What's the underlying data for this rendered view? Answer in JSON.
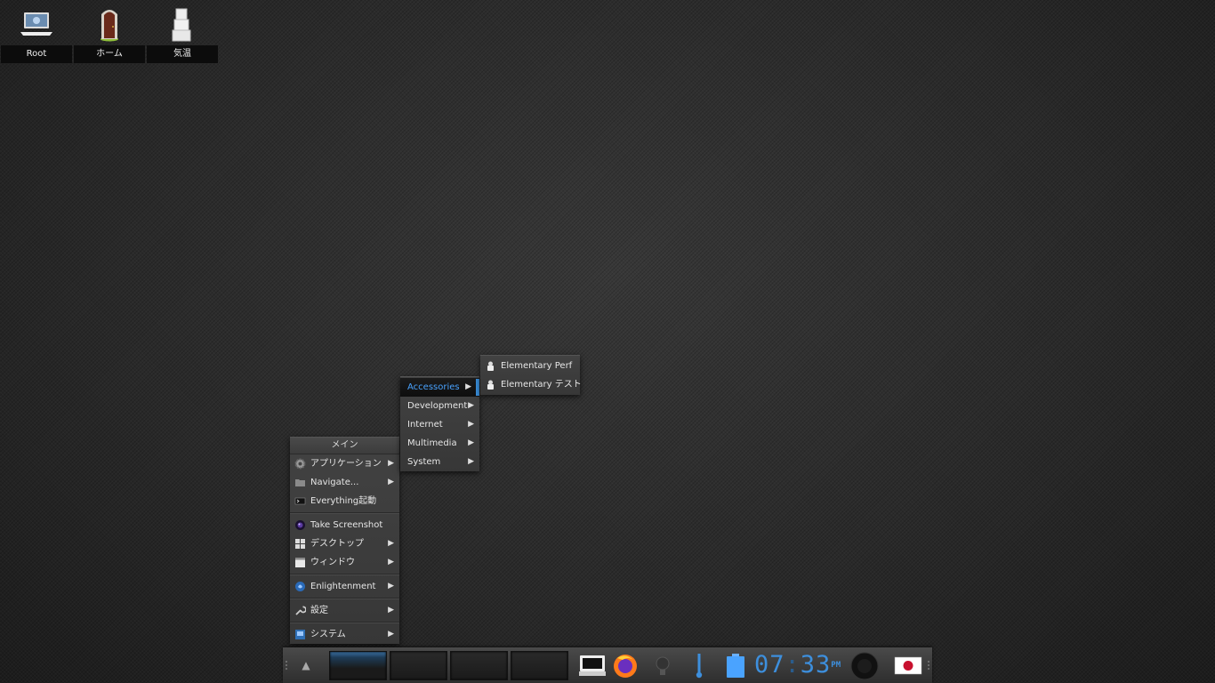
{
  "desktop_icons": [
    {
      "label": "Root",
      "icon": "computer-icon"
    },
    {
      "label": "ホーム",
      "icon": "home-door-icon"
    },
    {
      "label": "気温",
      "icon": "temperature-icon"
    }
  ],
  "main_menu": {
    "title": "メイン",
    "items": [
      {
        "label": "アプリケーション",
        "icon": "gear-icon",
        "submenu": true
      },
      {
        "label": "Navigate...",
        "icon": "folder-icon",
        "submenu": true
      },
      {
        "label": "Everything起動",
        "icon": "terminal-icon",
        "submenu": false
      },
      {
        "label": "Take Screenshot",
        "icon": "camera-icon",
        "submenu": false
      },
      {
        "label": "デスクトップ",
        "icon": "desktop-grid-icon",
        "submenu": true
      },
      {
        "label": "ウィンドウ",
        "icon": "window-icon",
        "submenu": true
      },
      {
        "label": "Enlightenment",
        "icon": "enlightenment-icon",
        "submenu": true
      },
      {
        "label": "設定",
        "icon": "wrench-icon",
        "submenu": true
      },
      {
        "label": "システム",
        "icon": "system-icon",
        "submenu": true
      }
    ]
  },
  "apps_menu": {
    "items": [
      {
        "label": "Accessories",
        "selected": true
      },
      {
        "label": "Development",
        "selected": false
      },
      {
        "label": "Internet",
        "selected": false
      },
      {
        "label": "Multimedia",
        "selected": false
      },
      {
        "label": "System",
        "selected": false
      }
    ]
  },
  "accessories_menu": {
    "items": [
      {
        "label": "Elementary Perf",
        "icon": "elementary-icon"
      },
      {
        "label": "Elementary テスト",
        "icon": "elementary-icon"
      }
    ]
  },
  "shelf": {
    "clock": {
      "hours": "07",
      "minutes": "33",
      "ampm": "PM"
    },
    "pager_active_desk": 1,
    "colors": {
      "accent": "#3d8fdd",
      "selection": "#4aa3ff"
    }
  }
}
